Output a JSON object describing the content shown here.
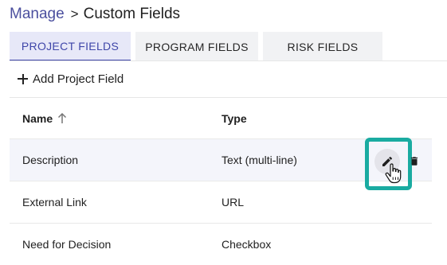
{
  "breadcrumb": {
    "parent": "Manage",
    "separator": ">",
    "current": "Custom Fields"
  },
  "tabs": [
    {
      "label": "PROJECT FIELDS",
      "active": true
    },
    {
      "label": "PROGRAM FIELDS",
      "active": false
    },
    {
      "label": "RISK FIELDS",
      "active": false
    }
  ],
  "toolbar": {
    "add_label": "Add Project Field",
    "add_icon": "plus-icon"
  },
  "table": {
    "columns": [
      {
        "label": "Name",
        "sort": "ascending",
        "sort_icon": "arrow-up-icon"
      },
      {
        "label": "Type"
      }
    ],
    "rows": [
      {
        "name": "Description",
        "type": "Text (multi-line)",
        "selected": true
      },
      {
        "name": "External Link",
        "type": "URL"
      },
      {
        "name": "Need for Decision",
        "type": "Checkbox"
      }
    ],
    "row_actions": {
      "edit_icon": "pencil-icon",
      "delete_icon": "trash-icon"
    }
  },
  "colors": {
    "accent": "#3f46a9",
    "breadcrumb_link": "#4b4f9e",
    "highlight": "#1aaba1",
    "selected_row": "#f4f5fb"
  }
}
